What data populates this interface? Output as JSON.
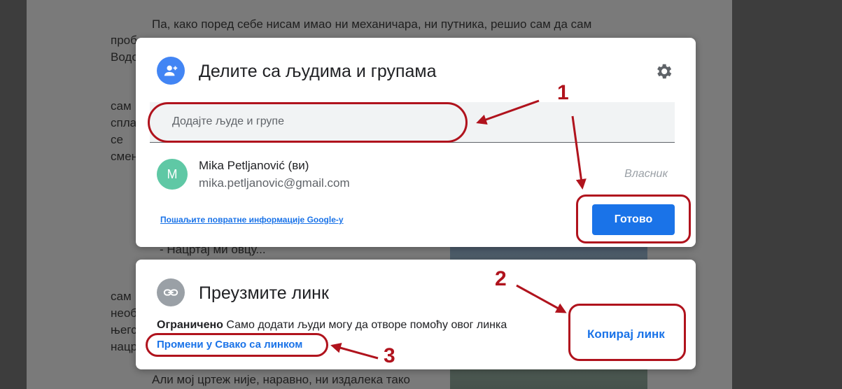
{
  "document": {
    "lines": [
      "Па, како поред себе нисам имао ни механичара, ни путника, решио сам да сам",
      "проб",
      "Водо",
      "сам",
      "спла",
      "се",
      "смен",
      "- Нацртај ми овцу...",
      "сам",
      "необ",
      "његс",
      "нацр",
      "Али мој цртеж није, наравно, ни издалека тако"
    ]
  },
  "share_dialog": {
    "title": "Делите са људима и групама",
    "icon": "person-add-icon",
    "settings_icon": "gear-icon",
    "search_placeholder": "Додајте људе и групе",
    "user": {
      "initial": "M",
      "name": "Mika Petljanović (ви)",
      "email": "mika.petljanovic@gmail.com",
      "role": "Власник"
    },
    "feedback_link": "Пошаљите повратне информације Google-у",
    "done_button": "Готово"
  },
  "link_dialog": {
    "title": "Преузмите линк",
    "icon": "link-icon",
    "restriction_label": "Ограничено",
    "restriction_text": "Само додати људи могу да отворе помоћу овог линка",
    "change_link": "Промени у Свако са линком",
    "copy_button": "Копирај линк"
  },
  "annotations": [
    "1",
    "2",
    "3"
  ],
  "colors": {
    "accent": "#1a73e8",
    "annotation": "#b0131d",
    "avatar": "#5fc8a5"
  }
}
